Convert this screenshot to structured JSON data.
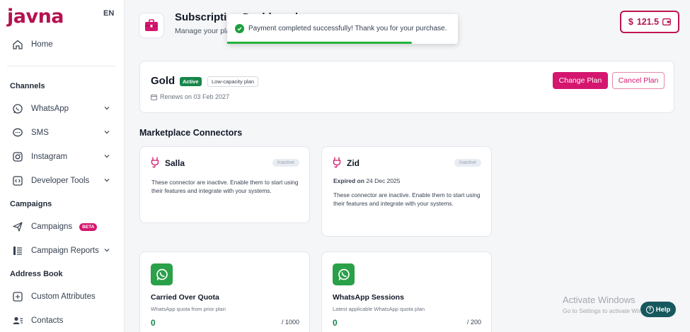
{
  "brand": {
    "logo_text": "javna",
    "language": "EN",
    "accent": "#d4166e"
  },
  "sidebar": {
    "home": "Home",
    "channels_title": "Channels",
    "channels": [
      "WhatsApp",
      "SMS",
      "Instagram",
      "Developer Tools"
    ],
    "campaigns_title": "Campaigns",
    "campaigns_item": "Campaigns",
    "beta_badge": "BETA",
    "campaign_reports": "Campaign Reports",
    "address_book_title": "Address Book",
    "custom_attributes": "Custom Attributes",
    "contacts": "Contacts"
  },
  "header": {
    "title": "Subscription Dashboard",
    "subtitle": "Manage your plan",
    "balance_currency": "$",
    "balance_value": "121.5"
  },
  "toast": {
    "message": "Payment completed successfully! Thank you for your purchase.",
    "progress": 0.8,
    "color": "#22b43b"
  },
  "plan": {
    "name": "Gold",
    "status": "Active",
    "tier": "Low-capacity plan",
    "renews": "Renews on 03 Feb 2027",
    "change_label": "Change Plan",
    "cancel_label": "Cancel Plan"
  },
  "marketplace": {
    "heading": "Marketplace Connectors",
    "connectors": [
      {
        "name": "Salla",
        "status": "Inactive",
        "description": "These connector are inactive. Enable them to start using their features and integrate with your systems."
      },
      {
        "name": "Zid",
        "status": "Inactive",
        "expired_label": "Expired on",
        "expired_date": "24 Dec 2025",
        "description": "These connector are inactive. Enable them to start using their features and integrate with your systems."
      }
    ]
  },
  "quotas": [
    {
      "title": "Carried Over Quota",
      "subtitle": "WhatsApp quota from prior plan",
      "value": "0",
      "max": "/ 1000"
    },
    {
      "title": "WhatsApp Sessions",
      "subtitle": "Latest applicable WhatsApp quota plan",
      "value": "0",
      "max": "/ 200"
    }
  ],
  "watermark": {
    "line1": "Activate Windows",
    "line2": "Go to Settings to activate Windows."
  },
  "help_label": "Help"
}
